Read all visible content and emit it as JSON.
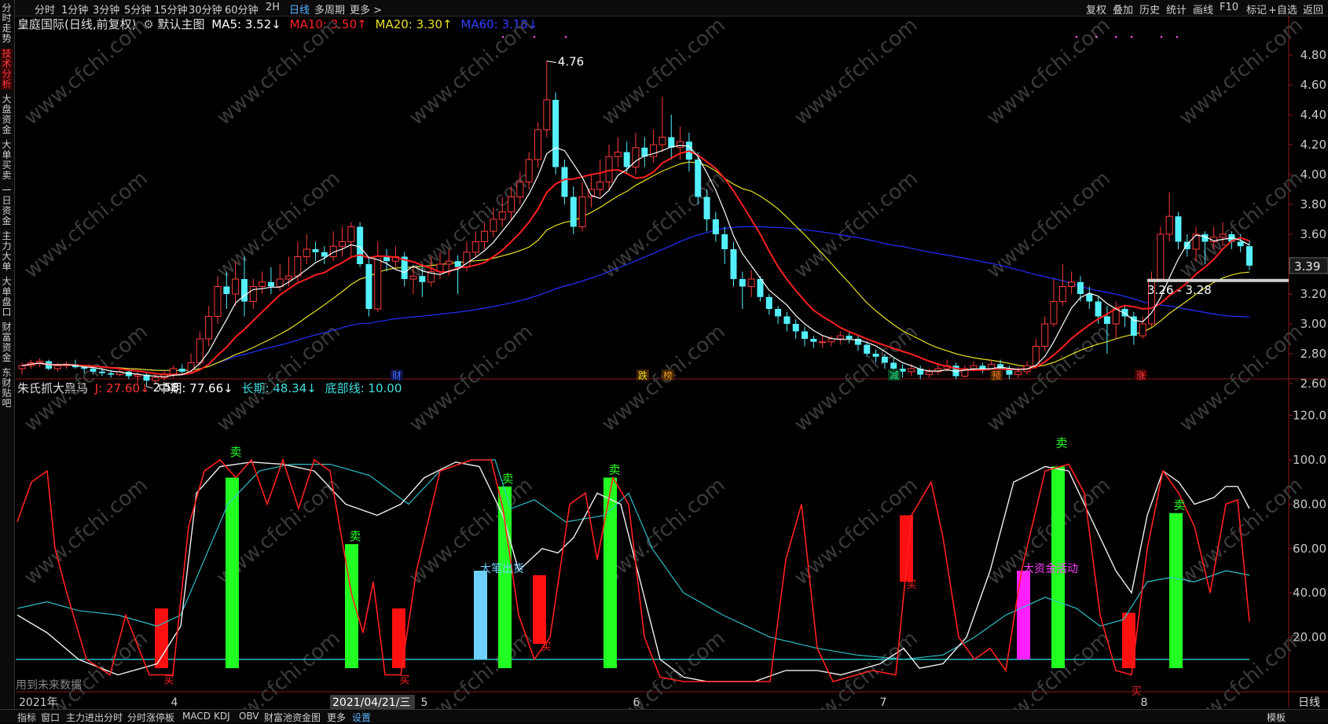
{
  "toolbar": {
    "timeframes": [
      "分时",
      "1分钟",
      "3分钟",
      "5分钟",
      "15分钟",
      "30分钟",
      "60分钟",
      "2H",
      "日线",
      "多周期",
      "更多 >"
    ],
    "active_timeframe": "日线",
    "right_buttons": [
      "复权",
      "叠加",
      "历史",
      "统计",
      "画线",
      "F10",
      "标记",
      "+自选",
      "返回"
    ]
  },
  "sidebar": {
    "tabs": [
      "分时走势",
      "技术分析",
      "大盘资金",
      "大单买卖",
      "一日资金",
      "主力大单",
      "大单盘口",
      "财富资金",
      "东财贴吧"
    ],
    "active_tab": "技术分析"
  },
  "main_legend": {
    "title": "皇庭国际(日线,前复权)",
    "chart_name": "默认主图",
    "ma5": "MA5: 3.52↓",
    "ma10": "MA10: 3.50↑",
    "ma20": "MA20: 3.30↑",
    "ma60": "MA60: 3.18↓"
  },
  "sub_legend": {
    "name": "朱氏抓大黑马",
    "j": "J: 27.60↓",
    "mid": "中期: 77.66↓",
    "long": "长期: 48.34↓",
    "bottom": "底部线: 10.00"
  },
  "price_axis": [
    "4.80",
    "4.60",
    "4.40",
    "4.20",
    "4.00",
    "3.80",
    "3.60",
    "3.40",
    "3.20",
    "3.00",
    "2.80",
    "2.60"
  ],
  "current_price": "3.39",
  "sub_axis": [
    "120.0",
    "100.0",
    "80.00",
    "60.00",
    "40.00",
    "20.00"
  ],
  "annotations": {
    "high": "4.76",
    "low": "2.58",
    "range": "3.26 - 3.28",
    "big_sell": "大笔出货",
    "big_fund": "大资金活动",
    "future_data": "用到未来数据",
    "sell": "卖",
    "buy": "买"
  },
  "event_markers": [
    "财",
    "跌",
    "榜",
    "减",
    "预",
    "涨"
  ],
  "dates": {
    "year": "2021年",
    "months": [
      "4",
      "5",
      "6",
      "7",
      "8"
    ],
    "cursor_date": "2021/04/21/三",
    "period_label": "日线"
  },
  "bottom_tabs": [
    "指标",
    "窗口",
    "主力进出分时",
    "分时涨停板",
    "MACD",
    "KDJ",
    "OBV",
    "财富池资金图",
    "更多",
    "设置"
  ],
  "bottom_right": "模板",
  "watermark": "www.cfchi.com",
  "colors": {
    "up": "#ff3b3b",
    "down": "#54f0ff",
    "ma5": "#ffffff",
    "ma10": "#ff2020",
    "ma20": "#e8e020",
    "ma60": "#2030ff",
    "sell_bar": "#22ff22",
    "buy_bar": "#ff1010",
    "big_sell_bar": "#6fd0ff",
    "big_fund_bar": "#ff20ff"
  }
}
